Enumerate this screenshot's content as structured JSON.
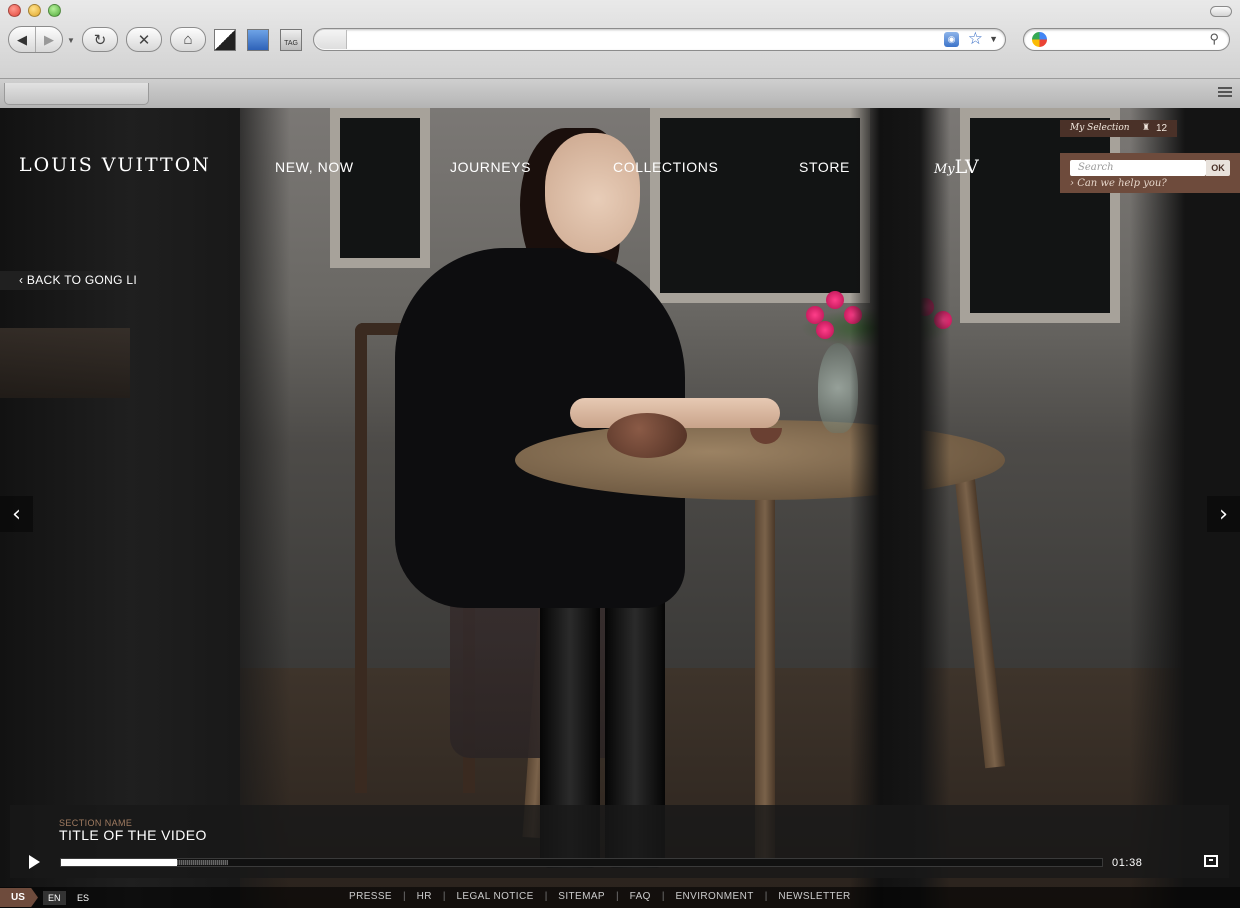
{
  "browser": {
    "address_value": "",
    "search_value": "",
    "tag_label": "TAG"
  },
  "brand": {
    "name": "LOUIS VUITTON"
  },
  "nav": {
    "items": [
      "NEW, NOW",
      "JOURNEYS",
      "COLLECTIONS",
      "STORE"
    ],
    "mylv_prefix": "My",
    "mylv_mark": "LV"
  },
  "selection": {
    "label": "My Selection",
    "count": "12"
  },
  "search": {
    "placeholder": "Search",
    "ok_label": "OK",
    "help_label": "Can we help you?"
  },
  "back_link": "‹ BACK TO GONG LI",
  "video": {
    "section_name": "SECTION NAME",
    "title": "TITLE OF THE VIDEO",
    "time": "01:38",
    "progress_played": 0.111,
    "progress_buffered": 0.16
  },
  "footer": {
    "country": "US",
    "languages": [
      "EN",
      "ES"
    ],
    "active_language": "EN",
    "links": [
      "PRESSE",
      "HR",
      "LEGAL NOTICE",
      "SITEMAP",
      "FAQ",
      "ENVIRONMENT",
      "NEWSLETTER"
    ]
  },
  "colors": {
    "brand_brown": "#6e4b3c",
    "selection_brown": "#4a3128",
    "section_label": "#a07b61"
  },
  "icons": [
    "back-icon",
    "forward-icon",
    "reload-icon",
    "stop-icon",
    "home-icon",
    "rss-icon",
    "bookmark-star-icon",
    "google-icon",
    "search-icon",
    "shopping-bag-icon",
    "play-icon",
    "fullscreen-icon",
    "chevron-left-icon",
    "chevron-right-icon"
  ]
}
